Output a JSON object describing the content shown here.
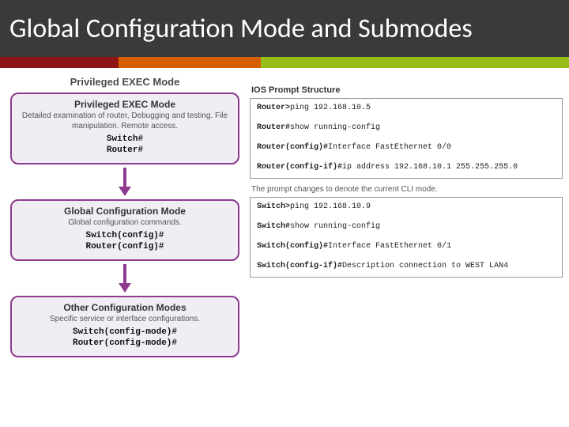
{
  "header": {
    "title": "Global Configuration Mode and Submodes"
  },
  "left": {
    "column_title": "Privileged EXEC Mode",
    "boxes": [
      {
        "title": "Privileged EXEC Mode",
        "desc": "Detailed examination of router, Debugging and testing. File manipulation. Remote access.",
        "code1": "Switch#",
        "code2": "Router#"
      },
      {
        "title": "Global Configuration Mode",
        "desc": "Global configuration commands.",
        "code1": "Switch(config)#",
        "code2": "Router(config)#"
      },
      {
        "title": "Other Configuration Modes",
        "desc": "Specific service or interface configurations.",
        "code1": "Switch(config-mode)#",
        "code2": "Router(config-mode)#"
      }
    ]
  },
  "right": {
    "ios_title": "IOS Prompt Structure",
    "router_lines": [
      {
        "prompt": "Router>",
        "cmd": "ping 192.168.10.5"
      },
      {
        "prompt": "Router#",
        "cmd": "show running-config"
      },
      {
        "prompt": "Router(config)#",
        "cmd": "Interface FastEthernet 0/0"
      },
      {
        "prompt": "Router(config-if)#",
        "cmd": "ip address 192.168.10.1 255.255.255.0"
      }
    ],
    "caption": "The prompt changes to denote the current CLI mode.",
    "switch_lines": [
      {
        "prompt": "Switch>",
        "cmd": "ping 192.168.10.9"
      },
      {
        "prompt": "Switch#",
        "cmd": "show running-config"
      },
      {
        "prompt": "Switch(config)#",
        "cmd": "Interface FastEthernet 0/1"
      },
      {
        "prompt": "Switch(config-if)#",
        "cmd": "Description connection to WEST LAN4"
      }
    ]
  }
}
